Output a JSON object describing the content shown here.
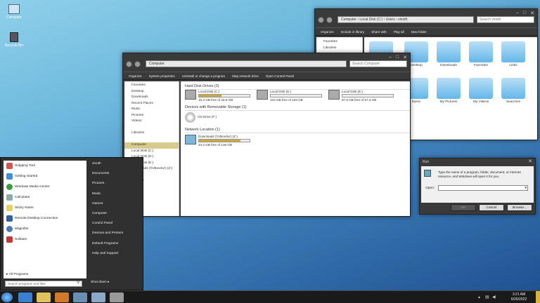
{
  "desktop": {
    "icons": [
      {
        "label": "Computer",
        "icon": "computer-icon"
      },
      {
        "label": "Recycle Bin",
        "icon": "recycle-bin-icon"
      }
    ]
  },
  "win_back": {
    "address": [
      "Computer",
      "Local Disk (C:)",
      "Users",
      "vinoth"
    ],
    "search_placeholder": "Search vinoth",
    "toolbar": [
      "Organize",
      "Include in library",
      "Share with",
      "Play all",
      "New folder"
    ],
    "nav": [
      "Favorites",
      "Libraries"
    ],
    "folders": [
      "",
      "Desktop",
      "Downloads",
      "Favorites",
      "Links",
      "",
      "Music",
      "My Pictures",
      "My Videos",
      "Searches"
    ]
  },
  "win_front": {
    "address": "Computer",
    "search_placeholder": "Search Computer",
    "toolbar": [
      "Organize",
      "System properties",
      "Uninstall or change a program",
      "Map network drive",
      "Open Control Panel"
    ],
    "nav": [
      "Favorites",
      "Desktop",
      "Downloads",
      "Recent Places",
      "Music",
      "Pictures",
      "Videos",
      "",
      "Libraries",
      "",
      "Computer",
      "Local Disk (C:)",
      "Local Disk (D:)",
      "Local Disk (E:)",
      "Downloads (\\\\VBoxSvr) (Z:)",
      "",
      "Network"
    ],
    "sections": {
      "hdd": "Hard Disk Drives (3)",
      "removable": "Devices with Removable Storage (1)",
      "network": "Network Location (1)"
    },
    "drives": [
      {
        "name": "Local Disk (C:)",
        "free": "16.3 GB free of 29.8 GB",
        "used_fraction": 0.45
      },
      {
        "name": "Local Disk (D:)",
        "free": "103 GB free of 103 GB",
        "used_fraction": 0.0
      },
      {
        "name": "Local Disk (E:)",
        "free": "97.5 GB free of 97.6 GB",
        "used_fraction": 0.0
      }
    ],
    "cd": {
      "name": "CD Drive (F:)"
    },
    "netdrive": {
      "name": "Downloads (\\\\VBoxSvr) (Z:)",
      "free": "24.3 GB free of 136 GB",
      "used_fraction": 0.82
    }
  },
  "run": {
    "title": "Run",
    "desc": "Type the name of a program, folder, document, or Internet resource, and Windows will open it for you.",
    "open_label": "Open:",
    "ok": "OK",
    "cancel": "Cancel",
    "browse": "Browse..."
  },
  "start": {
    "left": [
      "Snipping Tool",
      "Getting Started",
      "Windows Media Center",
      "Calculator",
      "Sticky Notes",
      "Remote Desktop Connection",
      "Magnifier",
      "Solitaire"
    ],
    "all_programs": "All Programs",
    "search_placeholder": "Search programs and files",
    "right": [
      "vinoth",
      "Documents",
      "Pictures",
      "Music",
      "Games",
      "Computer",
      "Control Panel",
      "Devices and Printers",
      "Default Programs",
      "Help and Support"
    ],
    "shutdown": "Shut down"
  },
  "taskbar": {
    "time": "3:21 AM",
    "date": "6/26/2022"
  }
}
